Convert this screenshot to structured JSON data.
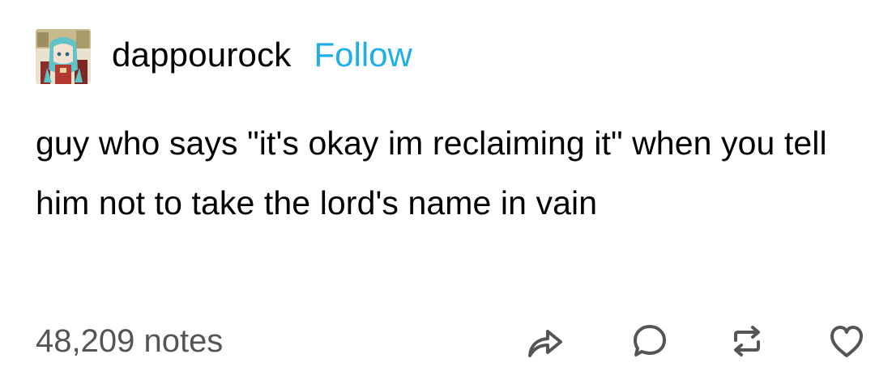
{
  "post": {
    "author": {
      "username": "dappourock",
      "follow_label": "Follow",
      "avatar_icon": "avatar-image"
    },
    "body": {
      "text": "guy who says \"it's okay im reclaiming it\" when you tell him not to take the lord's name in vain"
    },
    "footer": {
      "notes_label": "48,209 notes",
      "actions": [
        {
          "name": "share",
          "icon": "share-icon"
        },
        {
          "name": "reply",
          "icon": "reply-icon"
        },
        {
          "name": "reblog",
          "icon": "reblog-icon"
        },
        {
          "name": "like",
          "icon": "heart-icon"
        }
      ]
    },
    "colors": {
      "follow": "#1eaee8",
      "notes": "#555555",
      "text": "#000000",
      "icon": "#555555"
    }
  }
}
